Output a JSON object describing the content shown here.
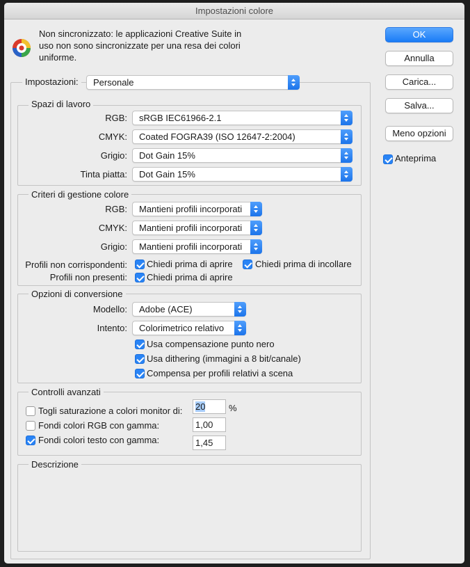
{
  "window": {
    "title": "Impostazioni colore"
  },
  "warning": {
    "text": "Non sincronizzato: le applicazioni Creative Suite in uso non sono sincronizzate per una resa dei colori uniforme.",
    "icon": "color-sync-warning-icon"
  },
  "buttons": {
    "ok": "OK",
    "cancel": "Annulla",
    "load": "Carica...",
    "save": "Salva...",
    "fewer": "Meno opzioni"
  },
  "preview": {
    "label": "Anteprima",
    "checked": true
  },
  "settings": {
    "label": "Impostazioni:",
    "value": "Personale"
  },
  "working_spaces": {
    "title": "Spazi di lavoro",
    "rgb_label": "RGB:",
    "rgb_value": "sRGB IEC61966-2.1",
    "cmyk_label": "CMYK:",
    "cmyk_value": "Coated FOGRA39 (ISO 12647-2:2004)",
    "gray_label": "Grigio:",
    "gray_value": "Dot Gain 15%",
    "spot_label": "Tinta piatta:",
    "spot_value": "Dot Gain 15%"
  },
  "policies": {
    "title": "Criteri di gestione colore",
    "rgb_label": "RGB:",
    "rgb_value": "Mantieni profili incorporati",
    "cmyk_label": "CMYK:",
    "cmyk_value": "Mantieni profili incorporati",
    "gray_label": "Grigio:",
    "gray_value": "Mantieni profili incorporati",
    "mismatch_label": "Profili non corrispondenti:",
    "mismatch_open": "Chiedi prima di aprire",
    "mismatch_paste": "Chiedi prima di incollare",
    "missing_label": "Profili non presenti:",
    "missing_open": "Chiedi prima di aprire"
  },
  "conversion": {
    "title": "Opzioni di conversione",
    "engine_label": "Modello:",
    "engine_value": "Adobe (ACE)",
    "intent_label": "Intento:",
    "intent_value": "Colorimetrico relativo",
    "bpc": "Usa compensazione punto nero",
    "dither": "Usa dithering (immagini a 8 bit/canale)",
    "scene": "Compensa per profili relativi a scena"
  },
  "advanced": {
    "title": "Controlli avanzati",
    "desat_label": "Togli saturazione a colori monitor di:",
    "desat_value": "20",
    "desat_unit": "%",
    "blend_rgb_label": "Fondi colori RGB con gamma:",
    "blend_rgb_value": "1,00",
    "blend_text_label": "Fondi colori testo con gamma:",
    "blend_text_value": "1,45"
  },
  "description": {
    "title": "Descrizione"
  },
  "colors": {
    "accent": "#2a84f5",
    "window_bg": "#ececec"
  }
}
